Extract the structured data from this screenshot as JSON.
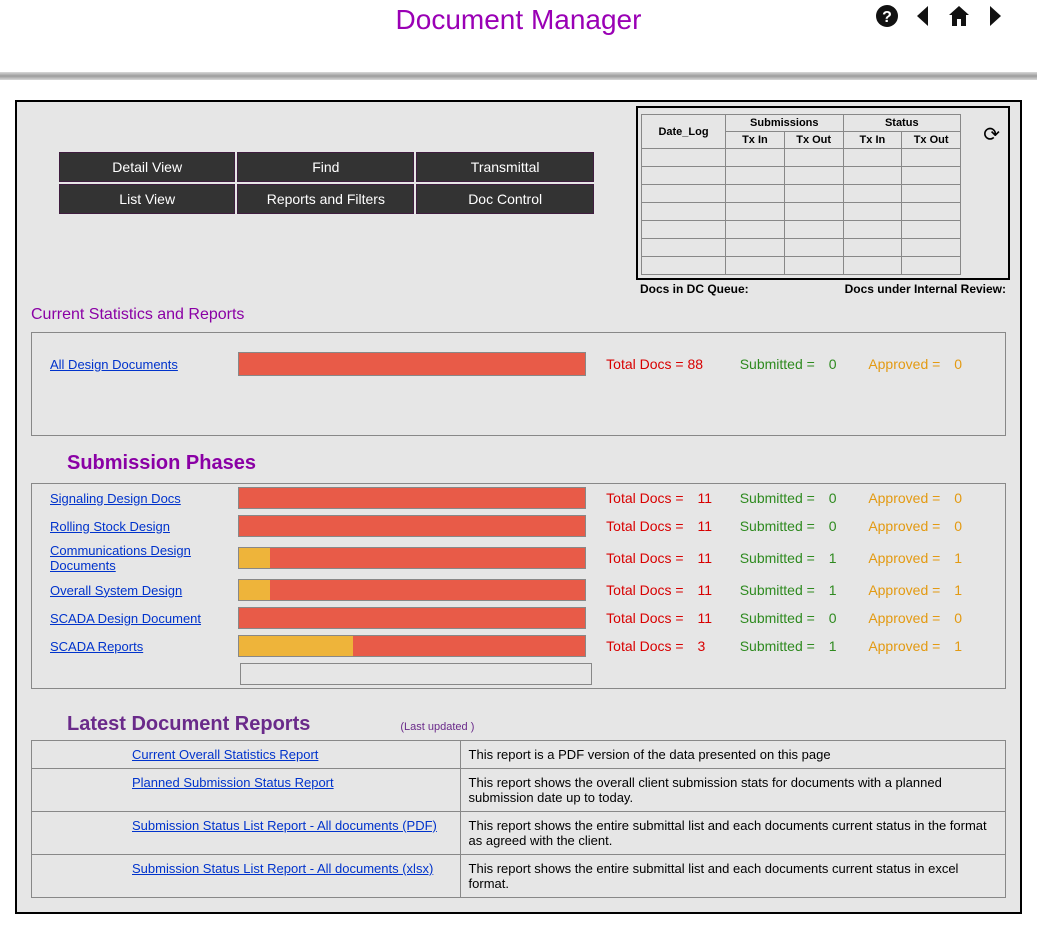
{
  "title": "Document Manager",
  "nav": [
    [
      "Detail View",
      "Find",
      "Transmittal"
    ],
    [
      "List View",
      "Reports and Filters",
      "Doc Control"
    ]
  ],
  "miniHeader": {
    "dateLog": "Date_Log",
    "subs": "Submissions",
    "status": "Status",
    "txIn": "Tx In",
    "txOut": "Tx Out"
  },
  "miniFooter": {
    "dc": "Docs in DC Queue:",
    "internal": "Docs under Internal Review:"
  },
  "sections": {
    "stats": "Current Statistics and Reports",
    "phases": "Submission Phases",
    "reports": "Latest Document Reports",
    "updated": "(Last updated )"
  },
  "labels": {
    "total": "Total Docs = ",
    "submitted": "Submitted = ",
    "approved": "Approved = "
  },
  "overall": {
    "link": "All Design Documents",
    "total": "88",
    "submitted": "0",
    "approved": "0",
    "pctY": 0,
    "pctR": 100
  },
  "phases": [
    {
      "link": "Signaling Design Docs",
      "total": "11",
      "submitted": "0",
      "approved": "0",
      "pctY": 0,
      "pctR": 100
    },
    {
      "link": "Rolling Stock Design",
      "total": "11",
      "submitted": "0",
      "approved": "0",
      "pctY": 0,
      "pctR": 100
    },
    {
      "link": "Communications Design Documents",
      "total": "11",
      "submitted": "1",
      "approved": "1",
      "pctY": 9,
      "pctR": 91
    },
    {
      "link": "Overall System Design",
      "total": "11",
      "submitted": "1",
      "approved": "1",
      "pctY": 9,
      "pctR": 91
    },
    {
      "link": "SCADA Design Document",
      "total": "11",
      "submitted": "0",
      "approved": "0",
      "pctY": 0,
      "pctR": 100
    },
    {
      "link": "SCADA Reports",
      "total": "3",
      "submitted": "1",
      "approved": "1",
      "pctY": 33,
      "pctR": 67
    }
  ],
  "reports": [
    {
      "link": "Current Overall Statistics Report",
      "desc": "This report is a PDF version of the data presented on this page"
    },
    {
      "link": "Planned Submission Status Report",
      "desc": "This report shows the overall client submission stats for documents with a planned submission date up to today."
    },
    {
      "link": "Submission Status List Report - All documents (PDF)",
      "desc": "This report shows the entire submittal list and each documents current status in the format as agreed with the client."
    },
    {
      "link": "Submission Status List Report - All documents (xlsx)",
      "desc": "This report shows the entire submittal list and each documents current status in excel format."
    }
  ],
  "chart_data": {
    "type": "bar",
    "title": "Submission Phases — document status bars",
    "series": [
      {
        "name": "All Design Documents",
        "total": 88,
        "submitted": 0,
        "approved": 0
      },
      {
        "name": "Signaling Design Docs",
        "total": 11,
        "submitted": 0,
        "approved": 0
      },
      {
        "name": "Rolling Stock Design",
        "total": 11,
        "submitted": 0,
        "approved": 0
      },
      {
        "name": "Communications Design Documents",
        "total": 11,
        "submitted": 1,
        "approved": 1
      },
      {
        "name": "Overall System Design",
        "total": 11,
        "submitted": 1,
        "approved": 1
      },
      {
        "name": "SCADA Design Document",
        "total": 11,
        "submitted": 0,
        "approved": 0
      },
      {
        "name": "SCADA Reports",
        "total": 3,
        "submitted": 1,
        "approved": 1
      }
    ]
  }
}
